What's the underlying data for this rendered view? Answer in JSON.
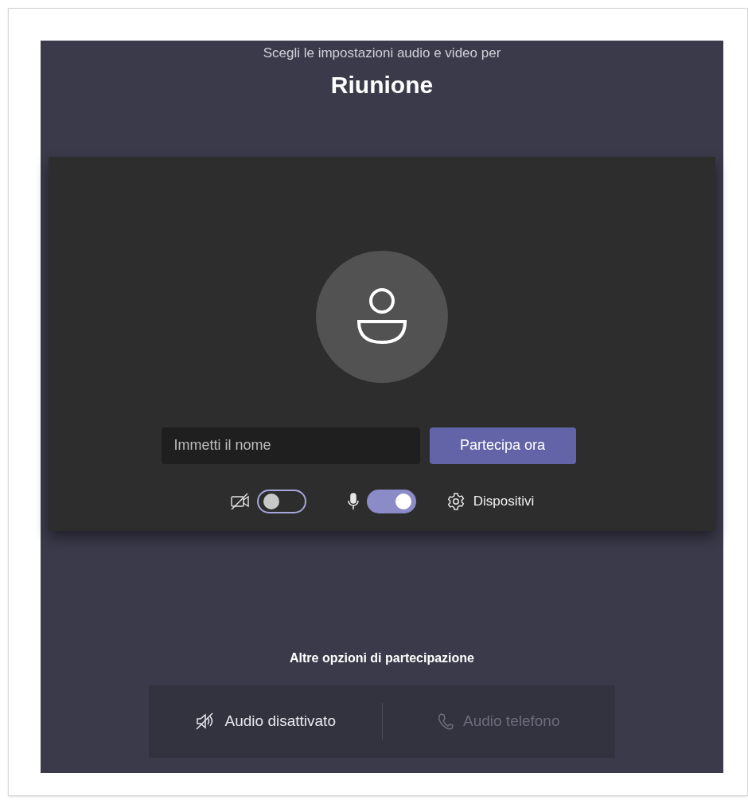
{
  "header": {
    "subtitle": "Scegli le impostazioni audio e video per",
    "title": "Riunione"
  },
  "name_field": {
    "placeholder": "Immetti il nome"
  },
  "join_button": "Partecipa ora",
  "controls": [
    {
      "kind": "camera",
      "on": false
    },
    {
      "kind": "microphone",
      "on": true
    }
  ],
  "devices_button": "Dispositivi",
  "other_options": {
    "heading": "Altre opzioni di partecipazione",
    "options": [
      {
        "kind": "audio_off",
        "label": "Audio disattivato",
        "disabled": false
      },
      {
        "kind": "phone",
        "label": "Audio telefono",
        "disabled": true
      }
    ]
  }
}
